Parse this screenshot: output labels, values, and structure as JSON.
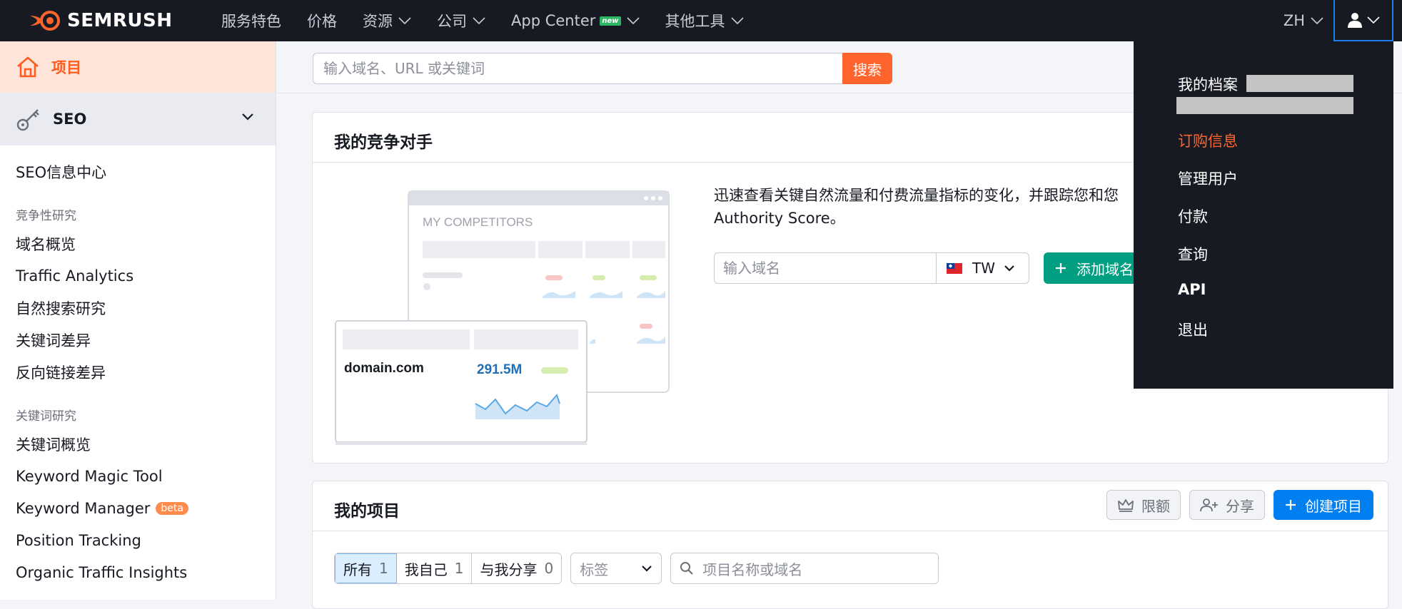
{
  "brand": {
    "name": "SEMRUSH"
  },
  "nav": {
    "items": [
      {
        "label": "服务特色",
        "has_menu": false
      },
      {
        "label": "价格",
        "has_menu": false
      },
      {
        "label": "资源",
        "has_menu": true
      },
      {
        "label": "公司",
        "has_menu": true
      },
      {
        "label": "App Center",
        "has_menu": true,
        "badge": "new"
      },
      {
        "label": "其他工具",
        "has_menu": true
      }
    ],
    "language": "ZH"
  },
  "search": {
    "placeholder": "输入域名、URL 或关键词",
    "button": "搜索"
  },
  "sidebar": {
    "project": "项目",
    "seo": "SEO",
    "seo_hub": "SEO信息中心",
    "sections": [
      {
        "title": "竞争性研究",
        "items": [
          "域名概览",
          "Traffic Analytics",
          "自然搜索研究",
          "关键词差异",
          "反向链接差异"
        ]
      },
      {
        "title": "关键词研究",
        "items": [
          "关键词概览",
          "Keyword Magic Tool",
          "Keyword Manager",
          "Position Tracking",
          "Organic Traffic Insights"
        ]
      }
    ],
    "beta_badge": "beta"
  },
  "competitors": {
    "title": "我的竞争对手",
    "description_line1": "迅速查看关键自然流量和付费流量指标的变化，并跟踪您和您",
    "description_line2": "Authority Score。",
    "domain_placeholder": "输入域名",
    "country": "TW",
    "add_button": "添加域名",
    "illustration": {
      "heading": "MY COMPETITORS",
      "sample_domain": "domain.com",
      "sample_value": "291.5M"
    }
  },
  "projects": {
    "title": "我的项目",
    "limits_button": "限额",
    "share_button": "分享",
    "create_button": "创建项目",
    "filters": [
      {
        "label": "所有",
        "count": "1",
        "active": true
      },
      {
        "label": "我自己",
        "count": "1",
        "active": false
      },
      {
        "label": "与我分享",
        "count": "0",
        "active": false
      }
    ],
    "tag_placeholder": "标签",
    "search_placeholder": "项目名称或域名"
  },
  "user_menu": {
    "profile": "我的档案",
    "subscription": "订购信息",
    "manage_users": "管理用户",
    "payment": "付款",
    "inquiries": "查询",
    "api": "API",
    "logout": "退出"
  },
  "colors": {
    "topbar": "#171a22",
    "brand_orange": "#ff642d",
    "teal": "#009f81",
    "blue": "#007ff0",
    "link_orange": "#ff642d"
  }
}
